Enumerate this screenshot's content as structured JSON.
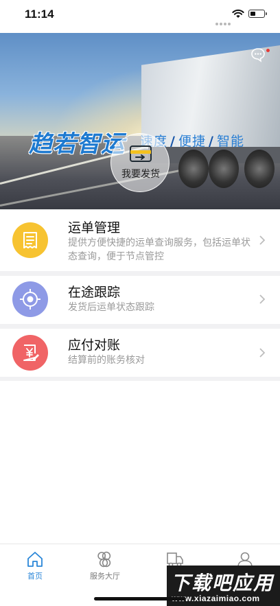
{
  "status_bar": {
    "time": "11:14"
  },
  "banner": {
    "brand": "趋若智运",
    "slogan": [
      "速度",
      "便捷",
      "智能"
    ],
    "ship_button_label": "我要发货"
  },
  "menu": [
    {
      "title": "运单管理",
      "desc": "提供方便快捷的运单查询服务，包括运单状态查询，便于节点管控",
      "color": "#f7c331",
      "icon": "receipt-icon"
    },
    {
      "title": "在途跟踪",
      "desc": "发货后运单状态跟踪",
      "color": "#8e9ae6",
      "icon": "target-icon"
    },
    {
      "title": "应付对账",
      "desc": "结算前的账务核对",
      "color": "#f06466",
      "icon": "yen-invoice-icon"
    }
  ],
  "tabbar": {
    "items": [
      {
        "label": "首页",
        "icon": "home-icon",
        "active": true
      },
      {
        "label": "服务大厅",
        "icon": "grid-icon",
        "active": false
      },
      {
        "label": "货",
        "icon": "truck-icon",
        "active": false
      },
      {
        "label": "",
        "icon": "user-icon",
        "active": false
      }
    ]
  },
  "colors": {
    "accent": "#2a86d8",
    "brand_blue": "#1e7ad0"
  },
  "watermark": {
    "main": "下载吧应用",
    "sub": "www.xiazaimiao.com"
  }
}
